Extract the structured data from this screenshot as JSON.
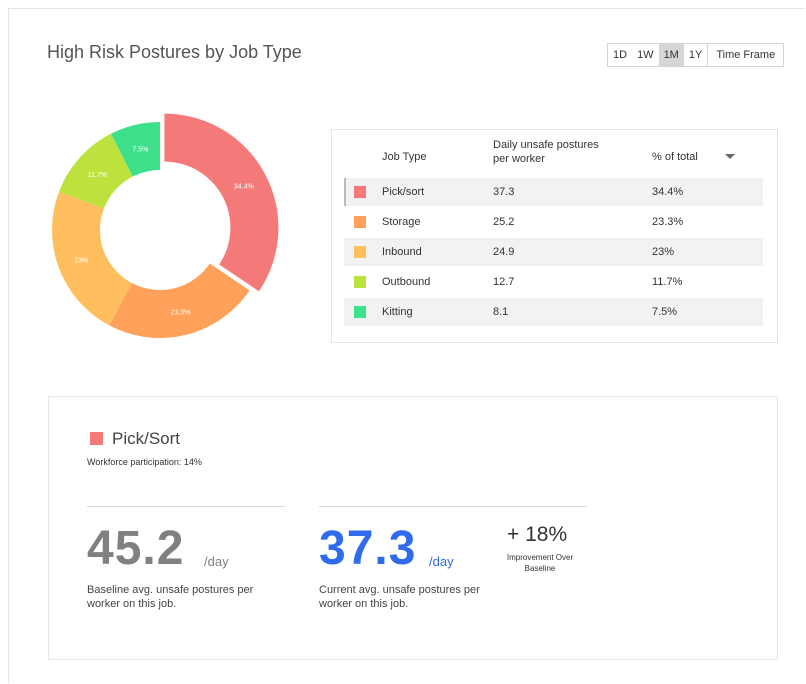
{
  "header": {
    "title": "High Risk Postures by Job Type"
  },
  "timeframe": {
    "options": [
      "1D",
      "1W",
      "1M",
      "1Y"
    ],
    "selected": "1M",
    "label": "Time Frame"
  },
  "chart_data": {
    "type": "pie",
    "style": "donut",
    "categories": [
      "Pick/sort",
      "Storage",
      "Inbound",
      "Outbound",
      "Kitting"
    ],
    "values": [
      34.4,
      23.3,
      23,
      11.7,
      7.5
    ],
    "labels": [
      "34.4%",
      "23.3%",
      "23%",
      "11.7%",
      "7.5%"
    ],
    "colors": [
      "#F47A7A",
      "#FFA15A",
      "#FFBF5F",
      "#BDE23E",
      "#3FE08C"
    ],
    "exploded_index": 0
  },
  "table": {
    "headers": {
      "job_type": "Job Type",
      "daily": "Daily unsafe postures per worker",
      "pct": "% of total"
    },
    "rows": [
      {
        "name": "Pick/sort",
        "daily": "37.3",
        "pct": "34.4%",
        "color": "#F47A7A"
      },
      {
        "name": "Storage",
        "daily": "25.2",
        "pct": "23.3%",
        "color": "#FFA15A"
      },
      {
        "name": "Inbound",
        "daily": "24.9",
        "pct": "23%",
        "color": "#FFBF5F"
      },
      {
        "name": "Outbound",
        "daily": "12.7",
        "pct": "11.7%",
        "color": "#BDE23E"
      },
      {
        "name": "Kitting",
        "daily": "8.1",
        "pct": "7.5%",
        "color": "#3FE08C"
      }
    ]
  },
  "detail": {
    "name": "Pick/Sort",
    "participation": "Workforce participation: 14%",
    "baseline": {
      "value": "45.2",
      "unit": "/day",
      "desc": "Baseline avg. unsafe postures per worker on this job.",
      "color": "#808080"
    },
    "current": {
      "value": "37.3",
      "unit": "/day",
      "desc": "Current avg. unsafe postures per worker on this job.",
      "color": "#2F6BEA"
    },
    "improvement": {
      "value": "+ 18%",
      "label": "Improvement Over Baseline"
    }
  }
}
